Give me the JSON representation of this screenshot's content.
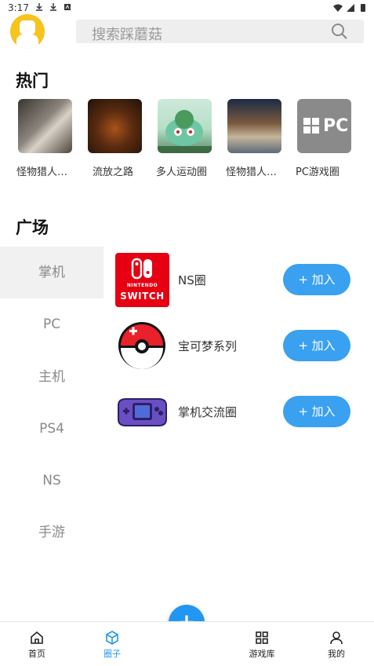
{
  "status_bar": {
    "time": "3:17"
  },
  "search": {
    "placeholder": "搜索踩蘑菇"
  },
  "hot": {
    "title": "热门",
    "items": [
      {
        "label": "怪物猎人…"
      },
      {
        "label": "流放之路"
      },
      {
        "label": "多人运动圈"
      },
      {
        "label": "怪物猎人…"
      },
      {
        "label": "PC游戏圈"
      }
    ]
  },
  "square": {
    "title": "广场",
    "categories": [
      {
        "label": "掌机",
        "selected": true
      },
      {
        "label": "PC",
        "selected": false
      },
      {
        "label": "主机",
        "selected": false
      },
      {
        "label": "PS4",
        "selected": false
      },
      {
        "label": "NS",
        "selected": false
      },
      {
        "label": "手游",
        "selected": false
      }
    ],
    "circles": [
      {
        "name": "NS圈",
        "join_label": "+ 加入",
        "logo_text": "SWITCH",
        "logo_small": "NINTENDO"
      },
      {
        "name": "宝可梦系列",
        "join_label": "+ 加入"
      },
      {
        "name": "掌机交流圈",
        "join_label": "+ 加入"
      }
    ]
  },
  "hot_thumb_pc_text": "PC",
  "fab_label": "+",
  "bottom_nav": [
    {
      "label": "首页",
      "active": false
    },
    {
      "label": "圈子",
      "active": true
    },
    {
      "label": "游戏库",
      "active": false
    },
    {
      "label": "我的",
      "active": false
    }
  ],
  "colors": {
    "accent": "#2196f3",
    "join_button": "#3aa0f0",
    "ns_red": "#e60012",
    "avatar_yellow": "#f7c31c"
  }
}
